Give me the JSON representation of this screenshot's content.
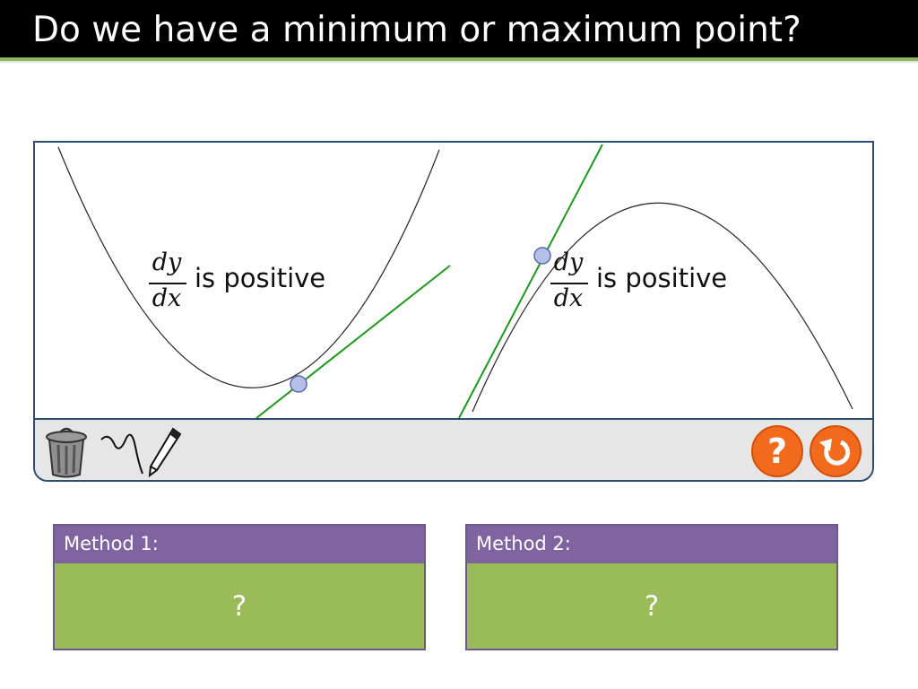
{
  "slide": {
    "title": "Do we have a minimum or maximum point?"
  },
  "graphs": {
    "left": {
      "derivative_num": "dy",
      "derivative_den": "dx",
      "text": "is positive"
    },
    "right": {
      "derivative_num": "dy",
      "derivative_den": "dx",
      "text": "is positive"
    }
  },
  "toolbar": {
    "tools": [
      "trash-icon",
      "freehand-curve-icon",
      "pencil-icon"
    ],
    "help_label": "?",
    "reset_icon": "reset-arrow-icon"
  },
  "methods": [
    {
      "title": "Method 1:",
      "answer": "?"
    },
    {
      "title": "Method 2:",
      "answer": "?"
    }
  ],
  "colors": {
    "title_bar": "#000000",
    "title_accent": "#8cb85c",
    "tangent_green": "#1a9a1a",
    "point_fill": "#b4c0e6",
    "method_header": "#8064a2",
    "method_body": "#9bbb59",
    "help_orange": "#f26a1b"
  }
}
